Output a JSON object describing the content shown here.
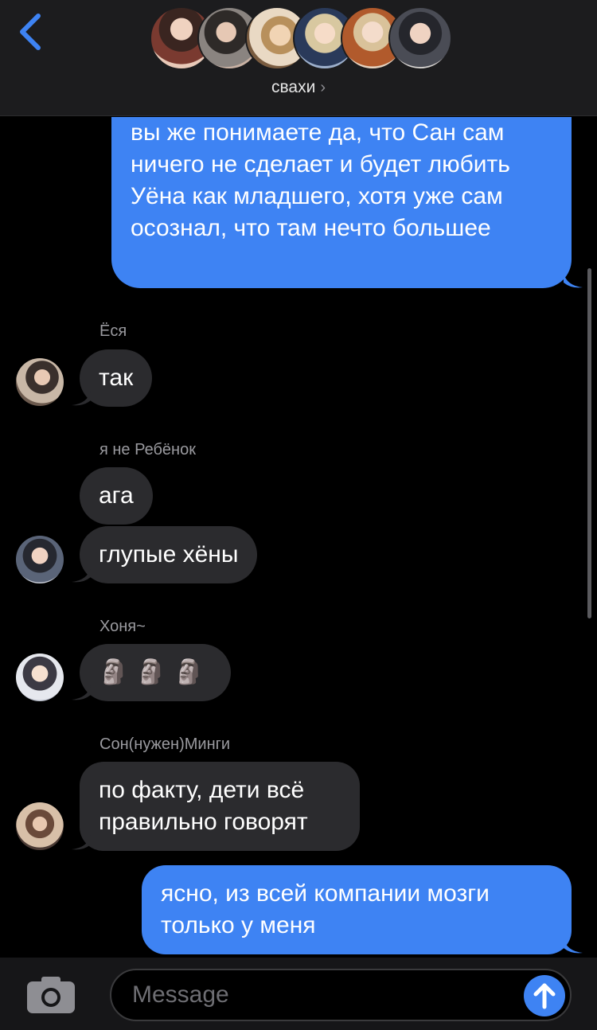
{
  "header": {
    "group_name": "свахи",
    "chevron": "›",
    "back_icon": "chevron-left-icon",
    "accent_color": "#3e83f3",
    "member_count": 6
  },
  "messages": [
    {
      "direction": "out",
      "text": "вы же понимаете да, что Сан сам ничего не сделает и будет любить Уёна как младшего, хотя уже сам осознал, что там нечто большее"
    },
    {
      "direction": "in",
      "sender": "Ёся",
      "text": "так"
    },
    {
      "direction": "in",
      "sender": "я не Ребёнок",
      "text": "ага"
    },
    {
      "direction": "in",
      "text": "глупые хёны"
    },
    {
      "direction": "in",
      "sender": "Хоня~",
      "text": "🗿🗿🗿"
    },
    {
      "direction": "in",
      "sender": "Сон(нужен)Минги",
      "text": "по факту, дети всё правильно говорят"
    },
    {
      "direction": "out",
      "text": "ясно, из всей компании мозги только у меня"
    }
  ],
  "composer": {
    "placeholder": "Message",
    "camera_icon": "camera-icon",
    "send_icon": "arrow-up-icon"
  }
}
